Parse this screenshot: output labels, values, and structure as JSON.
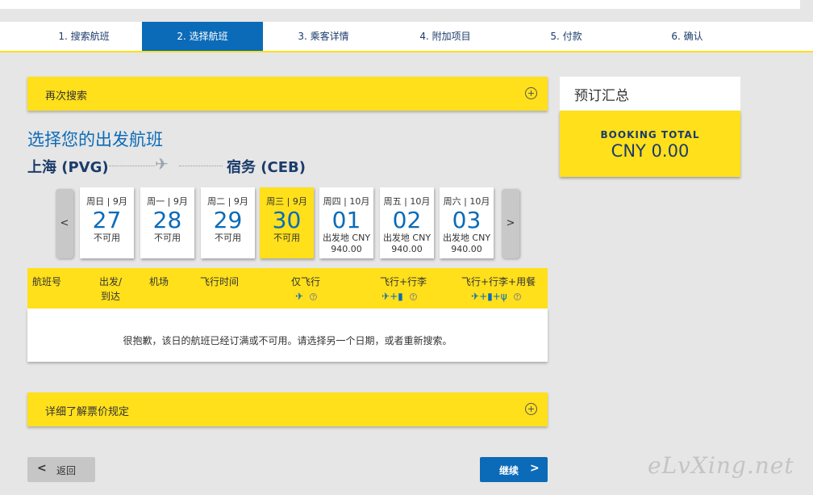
{
  "steps": [
    {
      "label": "1. 搜索航班"
    },
    {
      "label": "2. 选择航班"
    },
    {
      "label": "3. 乘客详情"
    },
    {
      "label": "4. 附加项目"
    },
    {
      "label": "5. 付款"
    },
    {
      "label": "6. 确认"
    }
  ],
  "search_again": {
    "label": "再次搜索"
  },
  "page_title": "选择您的出发航班",
  "route": {
    "origin": "上海 (PVG)",
    "destination": "宿务 (CEB)"
  },
  "date_nav": {
    "prev": "<",
    "next": ">"
  },
  "dates": [
    {
      "header": "周日 | 9月",
      "day": "27",
      "status": "不可用",
      "price": ""
    },
    {
      "header": "周一 | 9月",
      "day": "28",
      "status": "不可用",
      "price": ""
    },
    {
      "header": "周二 | 9月",
      "day": "29",
      "status": "不可用",
      "price": ""
    },
    {
      "header": "周三 | 9月",
      "day": "30",
      "status": "不可用",
      "price": ""
    },
    {
      "header": "周四 | 10月",
      "day": "01",
      "status": "出发地 CNY",
      "price": "940.00"
    },
    {
      "header": "周五 | 10月",
      "day": "02",
      "status": "出发地 CNY",
      "price": "940.00"
    },
    {
      "header": "周六 | 10月",
      "day": "03",
      "status": "出发地 CNY",
      "price": "940.00"
    }
  ],
  "table": {
    "col_flight": "航班号",
    "col_depart_1": "出发/",
    "col_depart_2": "到达",
    "col_airport": "机场",
    "col_duration": "飞行时间",
    "col_fly": "仅飞行",
    "col_fly_bag": "飞行+行李",
    "col_fly_bag_meal": "飞行+行李+用餐",
    "empty_message": "很抱歉，该日的航班已经订满或不可用。请选择另一个日期，或者重新搜索。"
  },
  "fare_rules": {
    "label": "详细了解票价规定"
  },
  "summary": {
    "title": "预订汇总",
    "booking_total_label": "BOOKING TOTAL",
    "amount": "CNY 0.00"
  },
  "buttons": {
    "back": "返回",
    "continue": "继续"
  },
  "watermark": "eLvXing.net",
  "colors": {
    "brand_yellow": "#ffe01b",
    "brand_blue": "#0b6bb8",
    "navy": "#1b3c6b"
  }
}
